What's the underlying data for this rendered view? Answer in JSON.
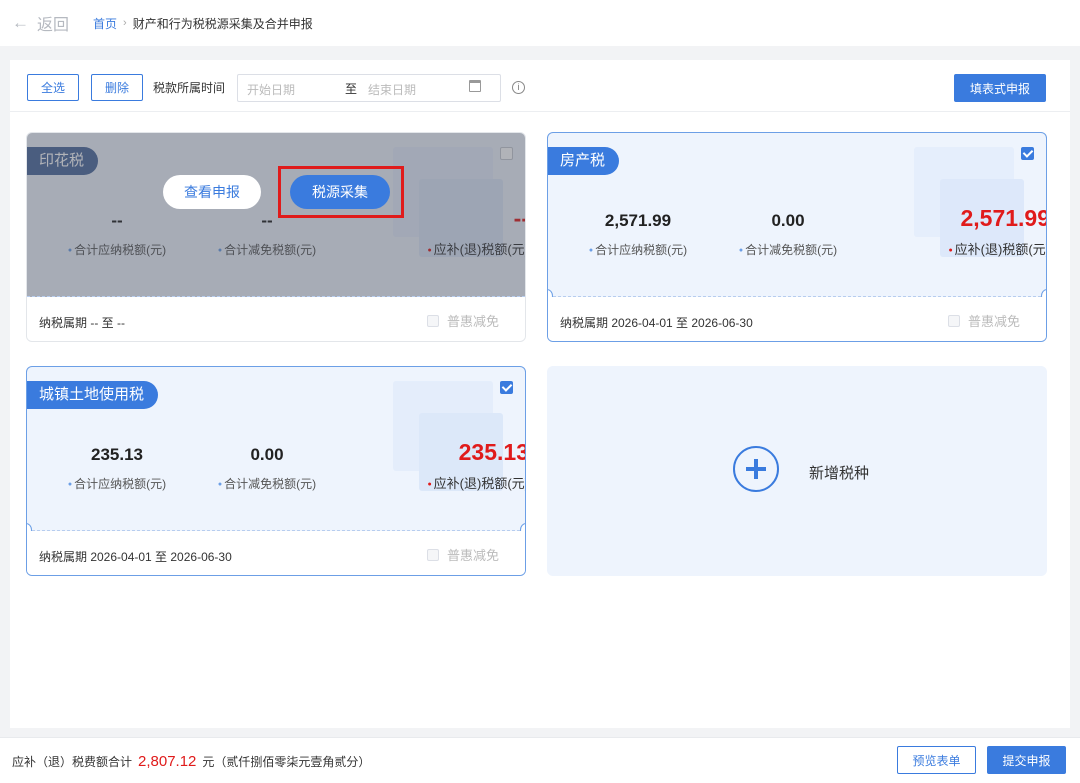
{
  "header": {
    "back_label": "返回",
    "breadcrumb_home": "首页",
    "breadcrumb_current": "财产和行为税税源采集及合并申报"
  },
  "toolbar": {
    "select_all": "全选",
    "delete": "删除",
    "period_label": "税款所属时间",
    "start_placeholder": "开始日期",
    "to": "至",
    "end_placeholder": "结束日期",
    "fill_report": "填表式申报"
  },
  "labels": {
    "total_payable": "合计应纳税额(元)",
    "total_relief": "合计减免税额(元)",
    "due": "应补(退)税额(元)",
    "inclusive_relief": "普惠减免"
  },
  "cards": [
    {
      "name": "印花税",
      "checked": false,
      "payable": "--",
      "relief": "--",
      "due": "--",
      "period": "纳税属期 -- 至 --",
      "view_btn": "查看申报",
      "collect_btn": "税源采集"
    },
    {
      "name": "房产税",
      "checked": true,
      "payable": "2,571.99",
      "relief": "0.00",
      "due": "2,571.99",
      "period": "纳税属期 2026-04-01 至 2026-06-30"
    },
    {
      "name": "城镇土地使用税",
      "checked": true,
      "payable": "235.13",
      "relief": "0.00",
      "due": "235.13",
      "period": "纳税属期 2026-04-01 至 2026-06-30"
    }
  ],
  "add_card": {
    "label": "新增税种"
  },
  "footer": {
    "sum_label": "应补（退）税费额合计",
    "sum_amount": "2,807.12",
    "sum_unit": "元（贰仟捌佰零柒元壹角贰分）",
    "preview": "预览表单",
    "submit": "提交申报"
  },
  "colors": {
    "accent": "#3a7bde",
    "due_red": "#e01b1b"
  }
}
